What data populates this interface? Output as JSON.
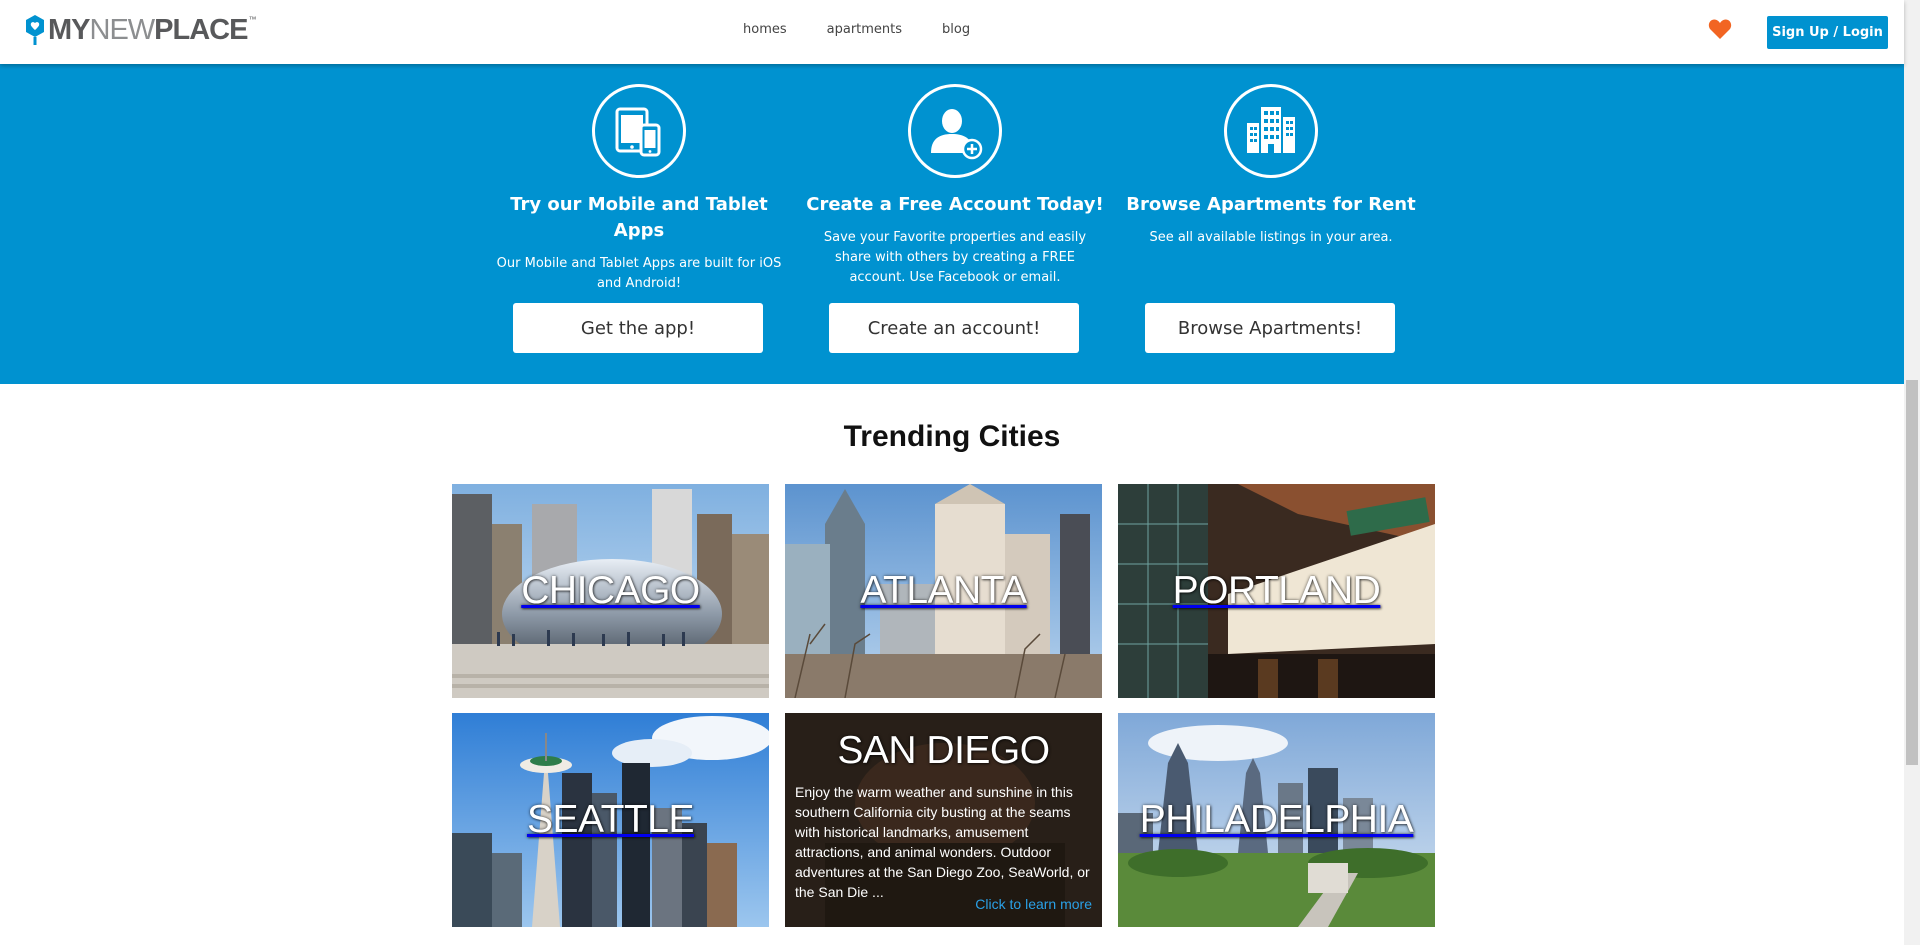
{
  "brand": {
    "my": "MY",
    "new": "NEW",
    "place": "PLACE",
    "tm": "™"
  },
  "nav": {
    "homes": "homes",
    "apartments": "apartments",
    "blog": "blog"
  },
  "header": {
    "signup_label": "Sign Up / Login",
    "heart_icon": "heart-icon",
    "heart_color": "#f26522"
  },
  "colors": {
    "accent": "#0092d0",
    "link": "#2aa0e6"
  },
  "features": [
    {
      "icon": "mobile-tablet-icon",
      "title": "Try our Mobile and Tablet Apps",
      "text": "Our Mobile and Tablet Apps are built for iOS and Android!",
      "button": "Get the app!"
    },
    {
      "icon": "user-add-icon",
      "title": "Create a Free Account Today!",
      "text": "Save your Favorite properties and easily share with others by creating a FREE account. Use Facebook or email.",
      "button": "Create an account!"
    },
    {
      "icon": "buildings-icon",
      "title": "Browse Apartments for Rent",
      "text": "See all available listings in your area.",
      "button": "Browse Apartments!"
    }
  ],
  "trending": {
    "title": "Trending Cities",
    "cities": [
      {
        "name": "CHICAGO"
      },
      {
        "name": "ATLANTA"
      },
      {
        "name": "PORTLAND"
      },
      {
        "name": "SEATTLE"
      },
      {
        "name": "SAN DIEGO",
        "description": "Enjoy the warm weather and sunshine in this southern California city busting at the seams with historical landmarks, amusement attractions, and animal wonders. Outdoor adventures at the San Diego Zoo, SeaWorld, or the San Die ...",
        "link": "Click to learn more"
      },
      {
        "name": "PHILADELPHIA"
      }
    ]
  }
}
